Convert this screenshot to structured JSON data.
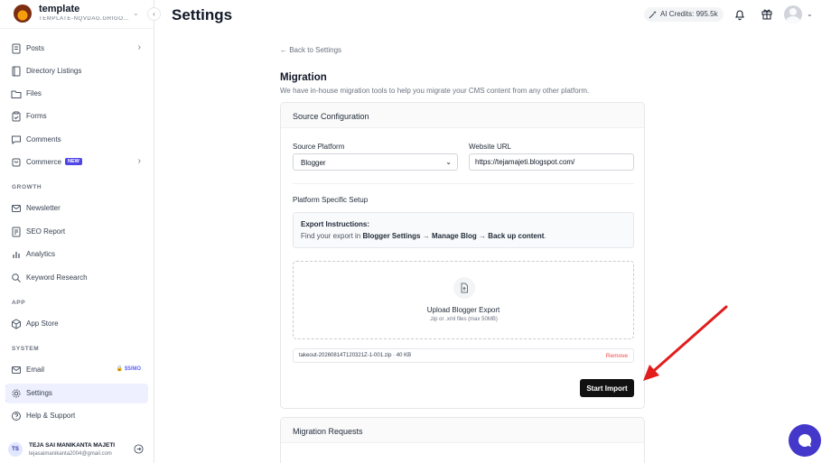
{
  "workspace": {
    "name": "template",
    "subtitle": "TEMPLATE-NQVDAG.GRIGOR..."
  },
  "sidebar": {
    "items_top": [
      {
        "label": "Posts",
        "icon": "document-icon",
        "has_arrow": true
      },
      {
        "label": "Directory Listings",
        "icon": "book-icon"
      },
      {
        "label": "Files",
        "icon": "folder-icon"
      },
      {
        "label": "Forms",
        "icon": "clipboard-icon"
      },
      {
        "label": "Comments",
        "icon": "comment-icon"
      },
      {
        "label": "Commerce",
        "icon": "cart-icon",
        "badge": "NEW",
        "has_arrow": true
      }
    ],
    "section_growth": "GROWTH",
    "items_growth": [
      {
        "label": "Newsletter",
        "icon": "mail-icon"
      },
      {
        "label": "SEO Report",
        "icon": "report-icon"
      },
      {
        "label": "Analytics",
        "icon": "chart-icon"
      },
      {
        "label": "Keyword Research",
        "icon": "search-icon"
      }
    ],
    "section_app": "APP",
    "items_app": [
      {
        "label": "App Store",
        "icon": "box-icon"
      }
    ],
    "section_system": "SYSTEM",
    "items_system": [
      {
        "label": "Email",
        "icon": "mail-icon",
        "price": "🔒 $5/MO"
      },
      {
        "label": "Settings",
        "icon": "gear-icon",
        "active": true
      },
      {
        "label": "Help & Support",
        "icon": "help-icon"
      }
    ],
    "user": {
      "initials": "TS",
      "name": "TEJA SAI MANIKANTA MAJETI",
      "email": "tejasaimanikanta2004@gmail.com"
    }
  },
  "header": {
    "title": "Settings",
    "ai_credits": "AI Credits: 995.5k"
  },
  "main": {
    "back_link": "← Back to Settings",
    "title": "Migration",
    "description": "We have in-house migration tools to help you migrate your CMS content from any other platform.",
    "source_config": {
      "heading": "Source Configuration",
      "platform_label": "Source Platform",
      "platform_value": "Blogger",
      "url_label": "Website URL",
      "url_value": "https://tejamajeti.blogspot.com/",
      "setup_label": "Platform Specific Setup",
      "instructions_title": "Export Instructions:",
      "instructions_prefix": "Find your export in ",
      "instructions_step1": "Blogger Settings",
      "instructions_arrow": " → ",
      "instructions_step2": "Manage Blog",
      "instructions_step3": "Back up content",
      "instructions_suffix": ".",
      "upload_title": "Upload Blogger Export",
      "upload_hint": ".zip or .xml files (max 50MB)",
      "file_name": "takeout-20260814T120321Z-1-001.zip · 40 KB",
      "remove_label": "Remove",
      "import_button": "Start Import"
    },
    "requests": {
      "heading": "Migration Requests"
    }
  },
  "colors": {
    "accent": "#4f46e5",
    "annotation_arrow": "#e11d1d",
    "chat_bubble": "#4338ca"
  }
}
